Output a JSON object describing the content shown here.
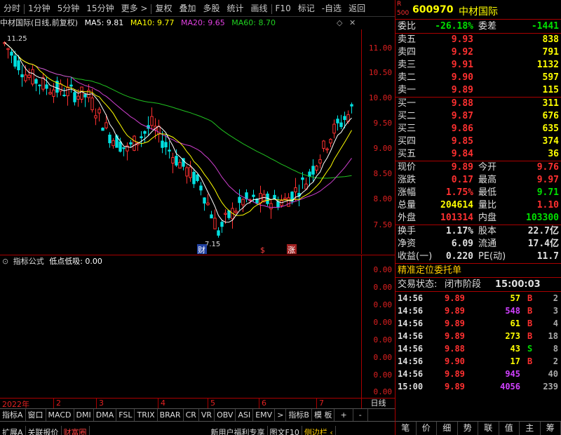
{
  "toolbar": {
    "items": [
      "分时",
      "1分钟",
      "5分钟",
      "15分钟",
      "更多 >",
      "复权",
      "叠加",
      "多股",
      "统计",
      "画线",
      "F10",
      "标记",
      "-自选",
      "返回"
    ]
  },
  "title": {
    "name": "中材国际(日线,前复权)",
    "ma5": "MA5: 9.81",
    "ma10": "MA10: 9.77",
    "ma20": "MA20: 9.65",
    "ma60": "MA60: 8.70"
  },
  "price_axis": [
    "11.00",
    "10.50",
    "10.00",
    "9.50",
    "9.00",
    "8.50",
    "8.00",
    "7.50"
  ],
  "annotations": {
    "high": "11.25",
    "low": "7.15",
    "marker1": "财",
    "marker2": "$",
    "marker3": "涨"
  },
  "indicator": {
    "label": "指标公式",
    "name": "低点低吸: 0.00",
    "axis": [
      "0.00",
      "0.00",
      "0.00",
      "0.00",
      "0.00",
      "0.00",
      "0.00",
      "0.00",
      "0.00",
      "0.00"
    ]
  },
  "date_axis": [
    "2022年",
    "2",
    "3",
    "4",
    "5",
    "6",
    "7"
  ],
  "period": "日线",
  "indicator_tabs": [
    "指标A",
    "窗口",
    "MACD",
    "DMI",
    "DMA",
    "FSL",
    "TRIX",
    "BRAR",
    "CR",
    "VR",
    "OBV",
    "ASI",
    "EMV",
    ">",
    "指标B",
    "模 板",
    "+",
    "-"
  ],
  "status_bar": [
    "扩展A",
    "关联报价",
    "财富圈",
    "新用户福利专享",
    "图文F10",
    "侧边栏 ‹"
  ],
  "stock": {
    "r_badge": "R",
    "code": "600970",
    "name": "中材国际",
    "r_num": "500"
  },
  "order_ratio": {
    "label1": "委比",
    "value1": "-26.18%",
    "label2": "委差",
    "value2": "-1441"
  },
  "sells": [
    {
      "label": "卖五",
      "price": "9.93",
      "vol": "838"
    },
    {
      "label": "卖四",
      "price": "9.92",
      "vol": "791"
    },
    {
      "label": "卖三",
      "price": "9.91",
      "vol": "1132"
    },
    {
      "label": "卖二",
      "price": "9.90",
      "vol": "597"
    },
    {
      "label": "卖一",
      "price": "9.89",
      "vol": "115"
    }
  ],
  "buys": [
    {
      "label": "买一",
      "price": "9.88",
      "vol": "311"
    },
    {
      "label": "买二",
      "price": "9.87",
      "vol": "676"
    },
    {
      "label": "买三",
      "price": "9.86",
      "vol": "635"
    },
    {
      "label": "买四",
      "price": "9.85",
      "vol": "374"
    },
    {
      "label": "买五",
      "price": "9.84",
      "vol": "36"
    }
  ],
  "quote": [
    {
      "l1": "现价",
      "v1": "9.89",
      "l2": "今开",
      "v2": "9.76"
    },
    {
      "l1": "涨跌",
      "v1": "0.17",
      "l2": "最高",
      "v2": "9.97"
    },
    {
      "l1": "涨幅",
      "v1": "1.75%",
      "l2": "最低",
      "v2": "9.71"
    },
    {
      "l1": "总量",
      "v1": "204614",
      "l2": "量比",
      "v2": "1.10"
    },
    {
      "l1": "外盘",
      "v1": "101314",
      "l2": "内盘",
      "v2": "103300"
    }
  ],
  "fundamentals": [
    {
      "l1": "换手",
      "v1": "1.17%",
      "l2": "股本",
      "v2": "22.7亿"
    },
    {
      "l1": "净资",
      "v1": "6.09",
      "l2": "流通",
      "v2": "17.4亿"
    },
    {
      "l1": "收益(一)",
      "v1": "0.220",
      "l2": "PE(动)",
      "v2": "11.7"
    }
  ],
  "precise_order": "精准定位委托单",
  "trade_state": {
    "label": "交易状态:",
    "value": "闭市阶段",
    "time": "15:00:03"
  },
  "ticks": [
    {
      "t": "14:56",
      "p": "9.89",
      "v": "57",
      "s": "B",
      "n": "2"
    },
    {
      "t": "14:56",
      "p": "9.89",
      "v": "548",
      "s": "B",
      "n": "3"
    },
    {
      "t": "14:56",
      "p": "9.89",
      "v": "61",
      "s": "B",
      "n": "4"
    },
    {
      "t": "14:56",
      "p": "9.89",
      "v": "273",
      "s": "B",
      "n": "18"
    },
    {
      "t": "14:56",
      "p": "9.88",
      "v": "43",
      "s": "S",
      "n": "8"
    },
    {
      "t": "14:56",
      "p": "9.90",
      "v": "17",
      "s": "B",
      "n": "2"
    },
    {
      "t": "14:56",
      "p": "9.89",
      "v": "945",
      "s": "",
      "n": "40"
    },
    {
      "t": "15:00",
      "p": "9.89",
      "v": "4056",
      "s": "",
      "n": "239"
    }
  ],
  "right_tabs": [
    "笔",
    "价",
    "细",
    "势",
    "联",
    "值",
    "主",
    "筹"
  ],
  "colors": {
    "up": "#ff3030",
    "down": "#00e0e0",
    "ma5": "#ffffff",
    "ma10": "#ffff00",
    "ma20": "#d040d0",
    "ma60": "#20c020"
  }
}
